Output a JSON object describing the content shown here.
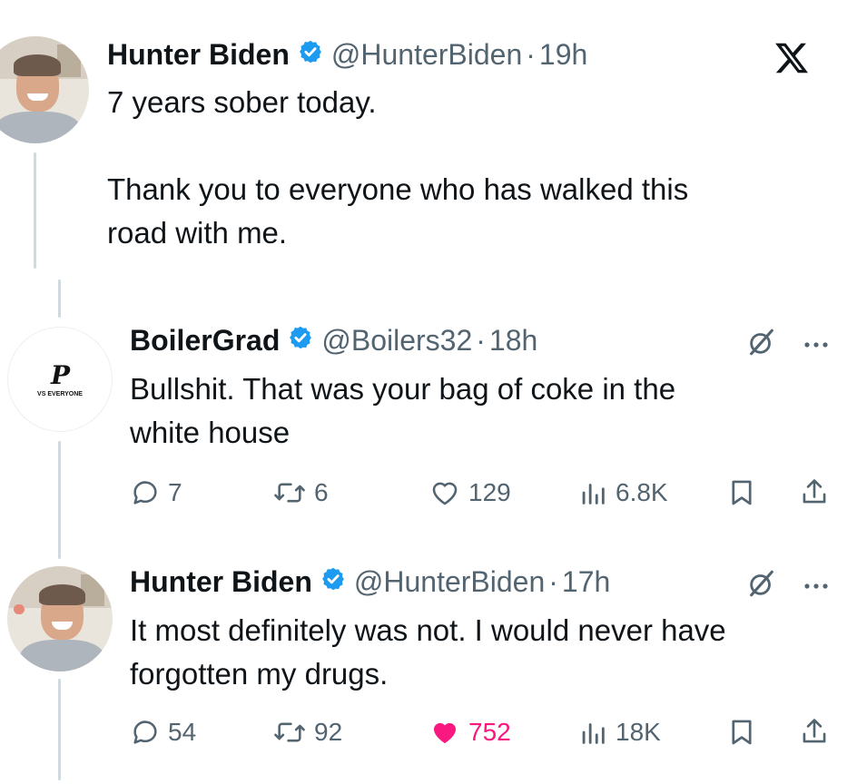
{
  "main_post": {
    "author": {
      "name": "Hunter Biden",
      "handle": "@HunterBiden",
      "verified": true
    },
    "time": "19h",
    "text": "7 years sober today.\n\nThank you to everyone who has walked this\nroad with me."
  },
  "platform_icon": "x-logo-icon",
  "replies": [
    {
      "author": {
        "name": "BoilerGrad",
        "handle": "@Boilers32",
        "verified": true
      },
      "avatar_text": {
        "mark": "P",
        "caption": "VS EVERYONE"
      },
      "time": "18h",
      "text": "Bullshit. That was your bag of coke in the\nwhite house",
      "actions": {
        "replies": "7",
        "reposts": "6",
        "likes": "129",
        "views": "6.8K"
      },
      "liked": false
    },
    {
      "author": {
        "name": "Hunter Biden",
        "handle": "@HunterBiden",
        "verified": true
      },
      "time": "17h",
      "text": "It most definitely was not. I would never have\nforgotten my drugs.",
      "actions": {
        "replies": "54",
        "reposts": "92",
        "likes": "752",
        "views": "18K"
      },
      "liked": true
    }
  ],
  "separator": "·",
  "colors": {
    "verified": "#1d9bf0",
    "liked": "#f91880",
    "secondary_text": "#536471",
    "thread_line": "#cfd9de"
  }
}
